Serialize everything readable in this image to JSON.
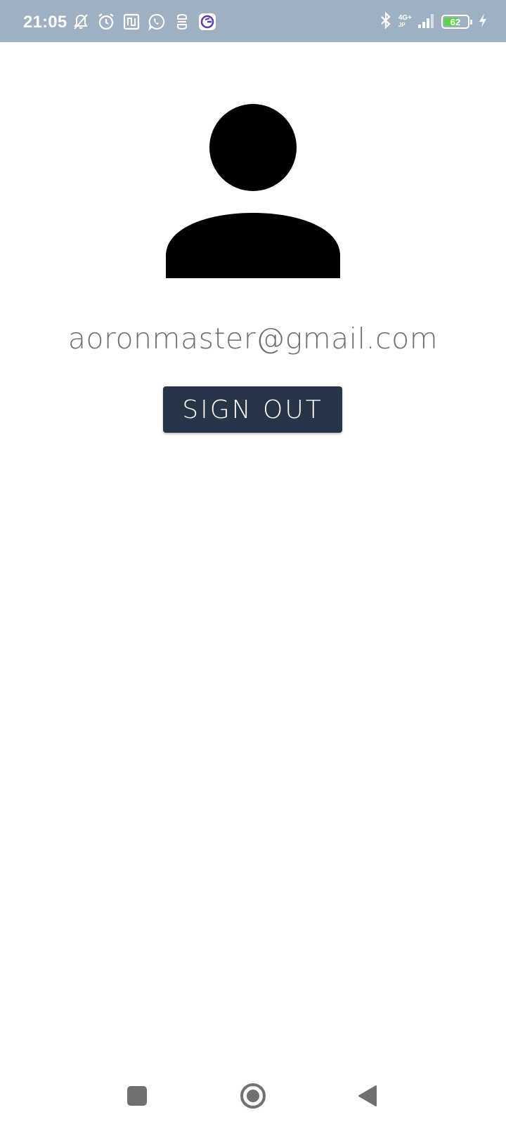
{
  "status_bar": {
    "time": "21:05",
    "network": "4G+",
    "network_sub": "JP",
    "battery_level": "62",
    "battery_fraction": 0.62,
    "icons_left": [
      "mute-icon",
      "alarm-icon",
      "nfc-icon",
      "whatsapp-icon",
      "app-icon",
      "grammarly-icon"
    ],
    "icons_right": [
      "bluetooth-icon",
      "signal-icon",
      "battery-icon",
      "charging-icon"
    ]
  },
  "profile": {
    "avatar_icon": "person-icon",
    "email": "aoronmaster@gmail.com"
  },
  "actions": {
    "sign_out_label": "SIGN OUT"
  },
  "navigation": {
    "buttons": [
      "recents-button",
      "home-button",
      "back-button"
    ]
  },
  "colors": {
    "status_bar_bg": "#9fb0c2",
    "button_bg": "#263548",
    "email_text": "#6f6f6f",
    "battery_fill": "#5fd14a"
  }
}
